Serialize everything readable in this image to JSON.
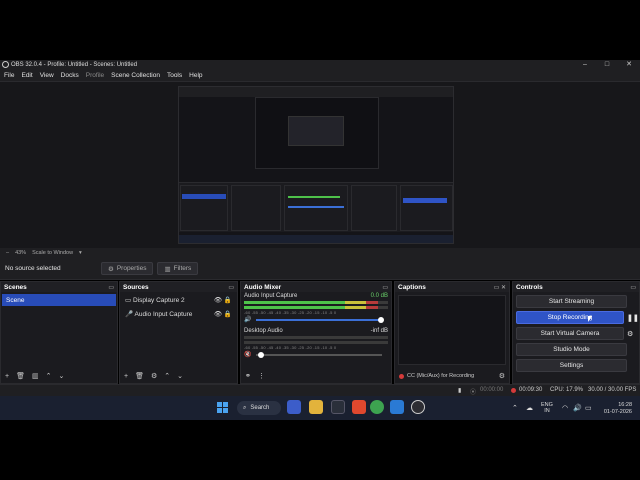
{
  "window": {
    "title": "OBS 32.0.4 - Profile: Untitled - Scenes: Untitled",
    "controls": [
      "–",
      "□",
      "✕"
    ]
  },
  "menu": [
    "File",
    "Edit",
    "View",
    "Docks",
    "Profile",
    "Scene Collection",
    "Tools",
    "Help"
  ],
  "preview": {
    "zoom_label": "43%",
    "scale_mode": "Scale to Window"
  },
  "context_bar": {
    "no_source": "No source selected",
    "properties": "Properties",
    "filters": "Filters"
  },
  "scenes": {
    "title": "Scenes",
    "items": [
      "Scene"
    ]
  },
  "sources": {
    "title": "Sources",
    "items": [
      "Display Capture 2",
      "Audio Input Capture"
    ]
  },
  "mixer": {
    "title": "Audio Mixer",
    "channels": [
      {
        "name": "Audio Input Capture",
        "level": "0.0 dB",
        "meter": 0.93
      },
      {
        "name": "Desktop Audio",
        "level": "-inf dB",
        "meter": 0.0
      }
    ],
    "scale": "-60 -55 -50 -45 -40 -35 -30 -25 -20 -15 -10 -5 0"
  },
  "captions": {
    "title": "Captions",
    "source_label": "CC (Mic/Aux) for Recording"
  },
  "controls": {
    "title": "Controls",
    "start_streaming": "Start Streaming",
    "stop_recording": "Stop Recording",
    "start_virtual_camera": "Start Virtual Camera",
    "studio_mode": "Studio Mode",
    "settings": "Settings"
  },
  "status": {
    "stream_time": "00:00:00",
    "rec_time": "00:09:30",
    "cpu": "CPU: 17.9%",
    "fps": "30.00 / 30.00 FPS"
  },
  "taskbar": {
    "search": "Search",
    "lang": "ENG",
    "region": "IN",
    "time": "16:28",
    "date": "01-07-2026"
  },
  "colors": {
    "accent": "#2f54c6",
    "selection": "#284cb8",
    "meter_green": "#4ec24a",
    "meter_red": "#b83b3b"
  }
}
